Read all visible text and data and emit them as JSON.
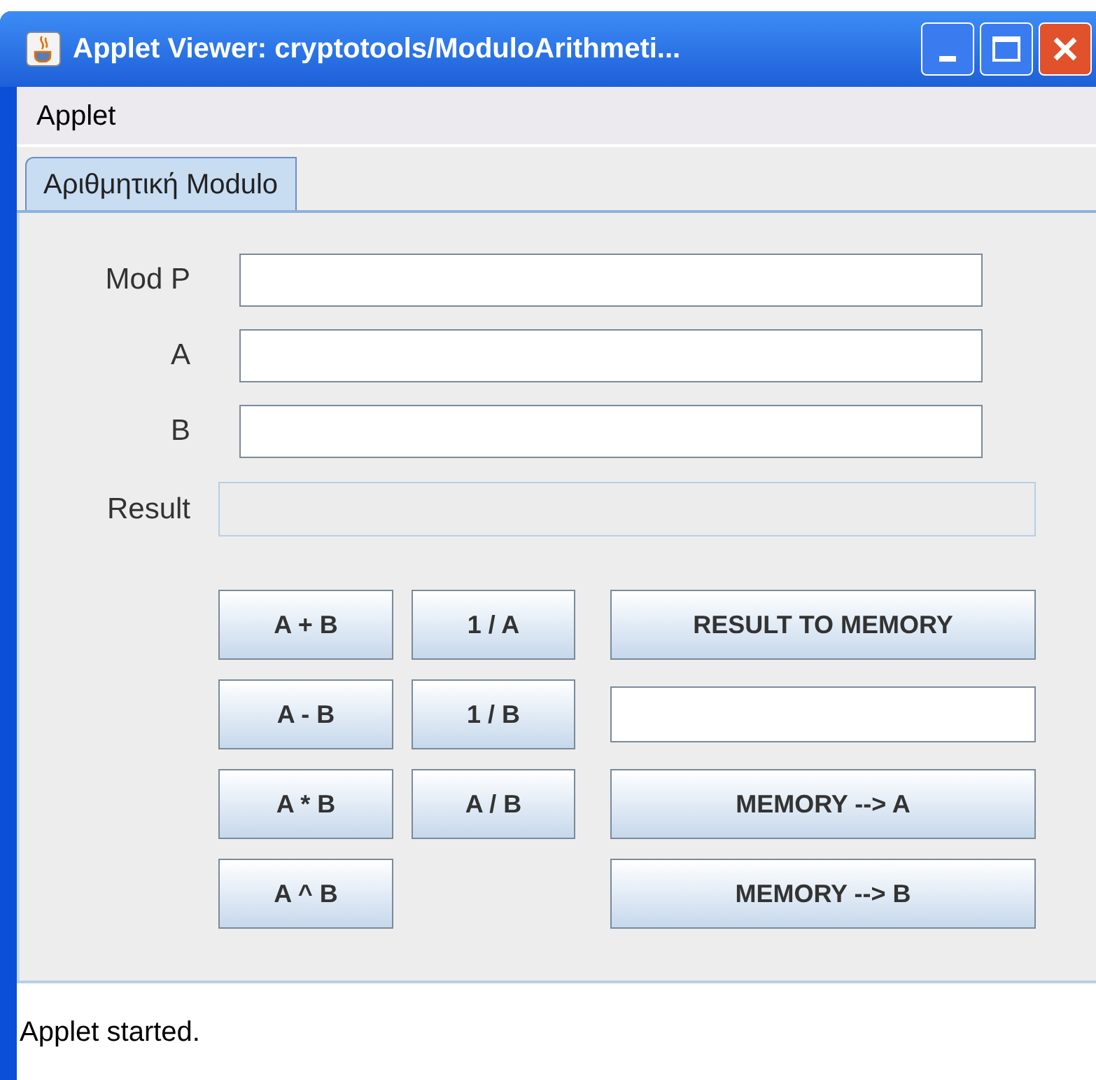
{
  "window": {
    "title": "Applet Viewer: cryptotools/ModuloArithmeti..."
  },
  "menu": [
    "Applet"
  ],
  "tabs": [
    {
      "label": "Αριθμητική Modulo",
      "selected": true
    }
  ],
  "fields": [
    {
      "label": "Mod P",
      "disabled": false
    },
    {
      "label": "A",
      "disabled": false
    },
    {
      "label": "B",
      "disabled": false
    },
    {
      "label": "Result",
      "disabled": true
    }
  ],
  "buttons_left": [
    {
      "kind": "button",
      "label": "A + B"
    },
    {
      "kind": "button",
      "label": "A - B"
    },
    {
      "kind": "button",
      "label": "A * B"
    },
    {
      "kind": "button",
      "label": "A ^ B"
    }
  ],
  "buttons_middle": [
    {
      "kind": "button",
      "label": "1 / A"
    },
    {
      "kind": "button",
      "label": "1 / B"
    },
    {
      "kind": "button",
      "label": "A / B"
    }
  ],
  "memory_column": [
    {
      "kind": "button",
      "label": "RESULT TO MEMORY"
    },
    {
      "kind": "field"
    },
    {
      "kind": "button",
      "label": "MEMORY --> A"
    },
    {
      "kind": "button",
      "label": "MEMORY --> B"
    }
  ],
  "status_bar": "Applet started."
}
